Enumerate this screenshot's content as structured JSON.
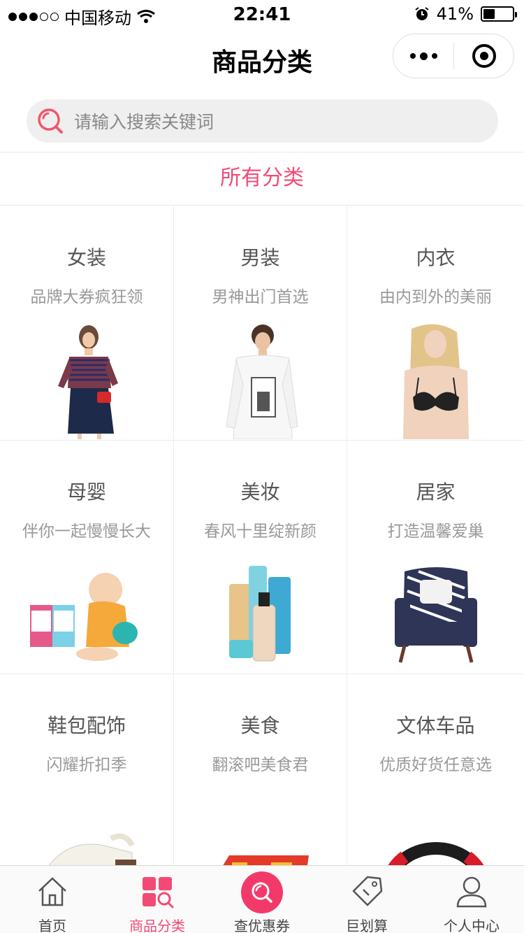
{
  "status_bar": {
    "carrier": "中国移动",
    "time": "22:41",
    "battery": "41%",
    "battery_level": 0.41
  },
  "nav": {
    "title": "商品分类"
  },
  "search": {
    "placeholder": "请输入搜索关键词"
  },
  "category_header": "所有分类",
  "categories": [
    {
      "name": "女装",
      "desc": "品牌大券疯狂领",
      "icon": "dress-model-image"
    },
    {
      "name": "男装",
      "desc": "男神出门首选",
      "icon": "menswear-model-image"
    },
    {
      "name": "内衣",
      "desc": "由内到外的美丽",
      "icon": "lingerie-model-image"
    },
    {
      "name": "母婴",
      "desc": "伴你一起慢慢长大",
      "icon": "baby-toys-image"
    },
    {
      "name": "美妆",
      "desc": "春风十里绽新颜",
      "icon": "cosmetics-image"
    },
    {
      "name": "居家",
      "desc": "打造温馨爱巢",
      "icon": "armchair-image"
    },
    {
      "name": "鞋包配饰",
      "desc": "闪耀折扣季",
      "icon": "shoe-image"
    },
    {
      "name": "美食",
      "desc": "翻滚吧美食君",
      "icon": "snack-box-image"
    },
    {
      "name": "文体车品",
      "desc": "优质好货任意选",
      "icon": "steering-wheel-image"
    }
  ],
  "tabs": [
    {
      "label": "首页",
      "icon": "home-icon",
      "active": false
    },
    {
      "label": "商品分类",
      "icon": "category-icon",
      "active": true
    },
    {
      "label": "查优惠券",
      "icon": "coupon-search-icon",
      "active": false
    },
    {
      "label": "巨划算",
      "icon": "tag-icon",
      "active": false
    },
    {
      "label": "个人中心",
      "icon": "user-icon",
      "active": false
    }
  ],
  "colors": {
    "accent": "#f24a73",
    "center_button": "#f23a6a"
  }
}
